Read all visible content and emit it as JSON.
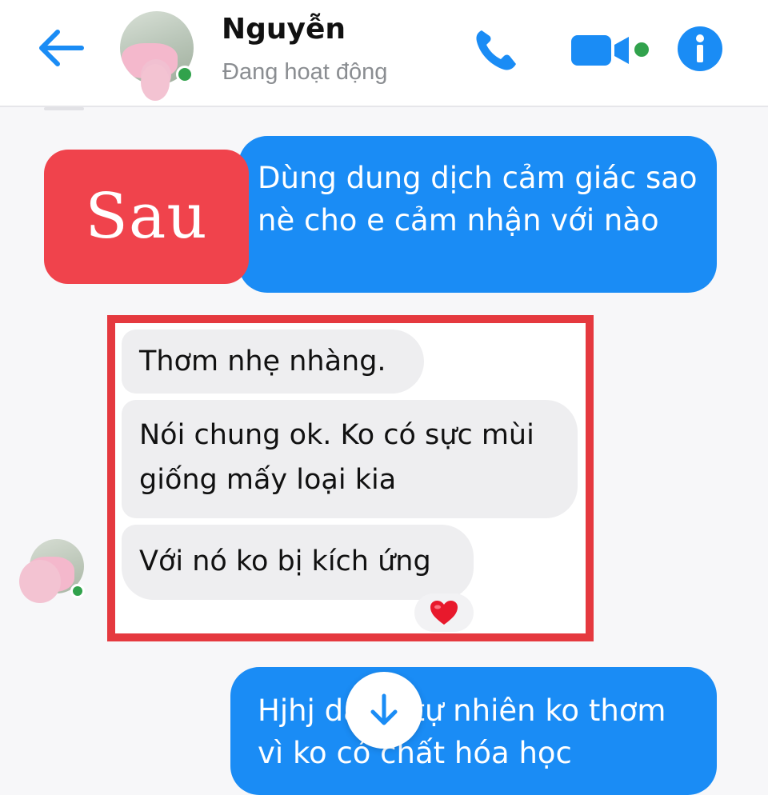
{
  "header": {
    "contact_name": "Nguyễn",
    "status": "Đang hoạt động",
    "icons": {
      "back": "arrow-left-icon",
      "call": "phone-icon",
      "video": "video-camera-icon",
      "info": "info-icon"
    },
    "accent_color": "#1a8cf5",
    "online_color": "#31a24c"
  },
  "label": {
    "text": "Sau",
    "color": "#f0434c"
  },
  "messages": [
    {
      "direction": "sent",
      "text": "Dùng dung dịch cảm giác sao nè cho e cảm nhận với nào"
    },
    {
      "direction": "received",
      "text": "Thơm nhẹ nhàng."
    },
    {
      "direction": "received",
      "text": "Nói chung ok. Ko có sực mùi giống mấy loại kia"
    },
    {
      "direction": "received",
      "text": "Với nó ko bị kích ứng",
      "reaction": "❤️"
    },
    {
      "direction": "sent",
      "text": "Hjhj dạ vs tự nhiên ko thơm vì ko có chất hóa học"
    }
  ],
  "highlight_color": "#e5393f",
  "scroll_button_icon": "arrow-down-icon"
}
